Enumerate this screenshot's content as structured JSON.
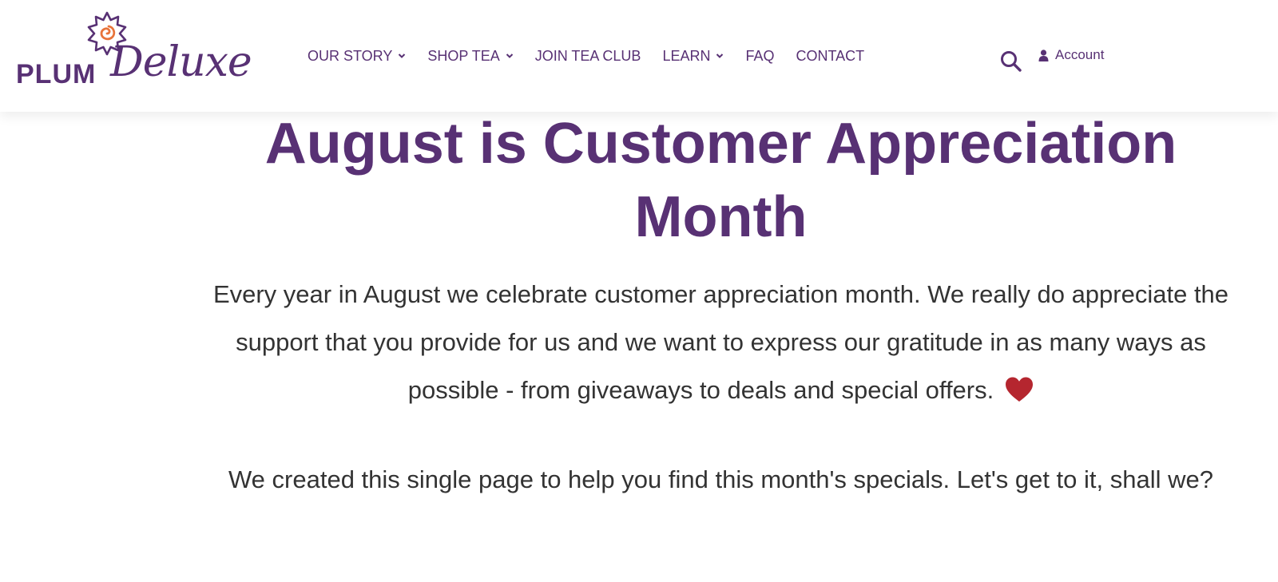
{
  "brand": {
    "logo_word1": "PLUM",
    "logo_word2": "Deluxe",
    "primary_color": "#583174",
    "sun_accent_color": "#e8743b"
  },
  "nav": {
    "items": [
      {
        "label": "OUR STORY",
        "has_dropdown": true
      },
      {
        "label": "SHOP TEA",
        "has_dropdown": true
      },
      {
        "label": "JOIN TEA CLUB",
        "has_dropdown": false
      },
      {
        "label": "LEARN",
        "has_dropdown": true
      },
      {
        "label": "FAQ",
        "has_dropdown": false
      },
      {
        "label": "CONTACT",
        "has_dropdown": false
      }
    ],
    "search_icon": "search-icon",
    "account_label": "Account",
    "account_icon": "user-icon"
  },
  "content": {
    "title": "August is Customer Appreciation Month",
    "paragraph1": "Every year in August we celebrate customer appreciation month.  We really do appreciate the support that you provide for us and we want to express our gratitude in as many ways as possible - from giveaways to deals and special offers.",
    "heart_icon": "heart-icon",
    "heart_color": "#b5262f",
    "paragraph2": "We created this single page to help you find this month's specials.  Let's get to it, shall we?"
  }
}
